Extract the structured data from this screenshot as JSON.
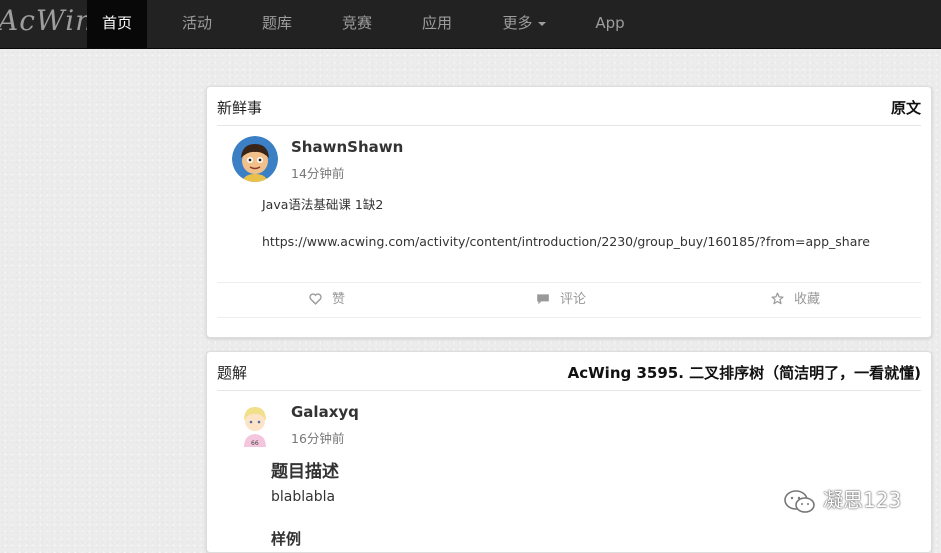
{
  "brand": "AcWing",
  "nav": {
    "items": [
      {
        "label": "首页",
        "active": true
      },
      {
        "label": "活动"
      },
      {
        "label": "题库"
      },
      {
        "label": "竞赛"
      },
      {
        "label": "应用"
      },
      {
        "label": "更多",
        "dropdown": true
      },
      {
        "label": "App"
      }
    ]
  },
  "post1": {
    "category": "新鲜事",
    "link": "原文",
    "author": "ShawnShawn",
    "time": "14分钟前",
    "line1": "Java语法基础课 1缺2",
    "line2": "https://www.acwing.com/activity/content/introduction/2230/group_buy/160185/?from=app_share",
    "actions": {
      "like": "赞",
      "comment": "评论",
      "favorite": "收藏"
    }
  },
  "post2": {
    "category": "题解",
    "link": "AcWing 3595. 二叉排序树（简洁明了，一看就懂)",
    "author": "Galaxyq",
    "time": "16分钟前",
    "heading": "题目描述",
    "body": "blablabla",
    "heading2": "样例"
  },
  "watermark": "凝思123"
}
